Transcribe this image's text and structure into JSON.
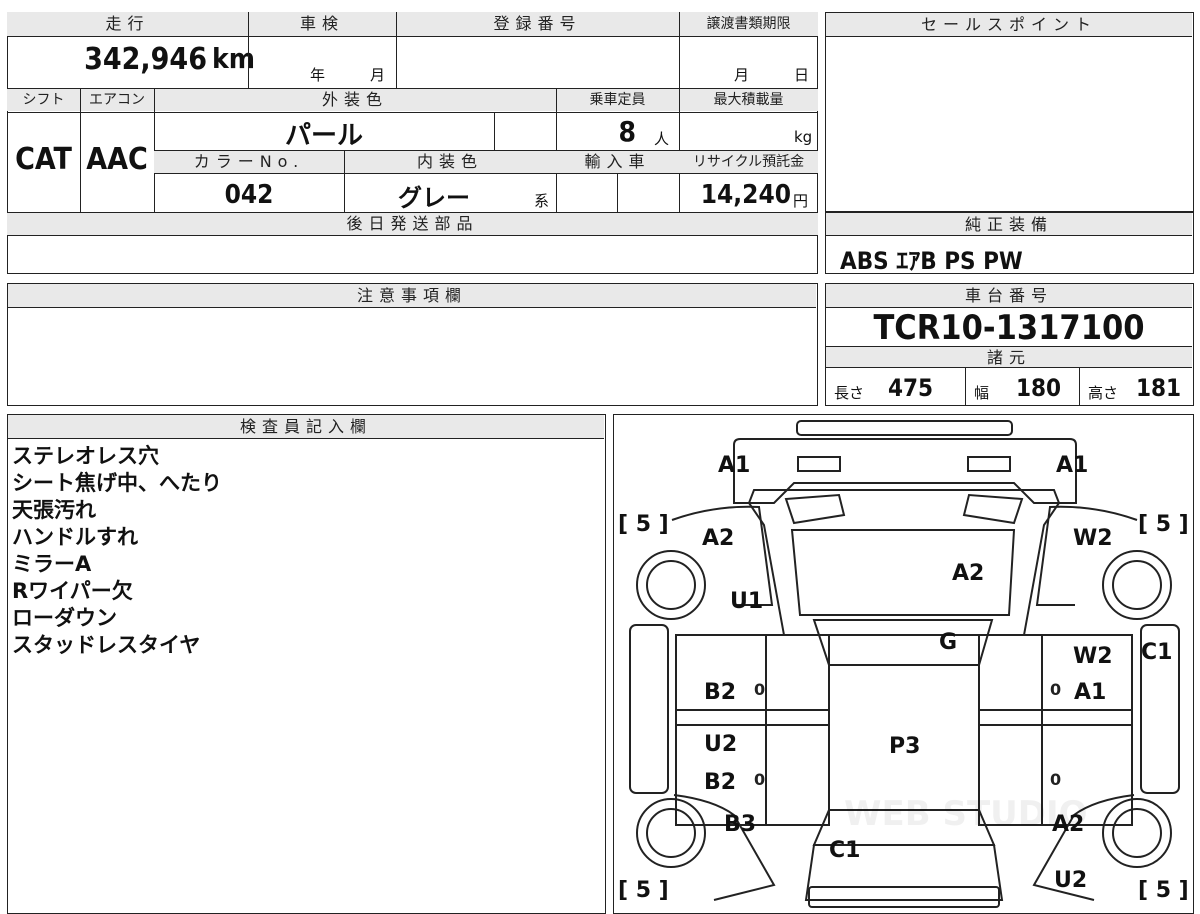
{
  "vehicle": {
    "mileage_header": "走行",
    "mileage_value": "342,946",
    "mileage_unit": "km",
    "inspection_header": "車検",
    "inspection_year_label": "年",
    "inspection_month_label": "月",
    "registration_header": "登録番号",
    "transfer_header": "譲渡書類期限",
    "transfer_month_label": "月",
    "transfer_day_label": "日",
    "shift_header": "シフト",
    "shift_value": "CAT",
    "aircon_header": "エアコン",
    "aircon_value": "AAC",
    "exterior_color_header": "外装色",
    "exterior_color_value": "パール",
    "capacity_header": "乗車定員",
    "capacity_value": "8",
    "capacity_unit": "人",
    "max_load_header": "最大積載量",
    "max_load_unit": "kg",
    "color_no_header": "カラーNo.",
    "color_no_value": "042",
    "interior_color_header": "内装色",
    "interior_color_value": "グレー",
    "interior_color_suffix": "系",
    "import_header": "輸入車",
    "recycle_header": "リサイクル預託金",
    "recycle_value": "14,240",
    "recycle_unit": "円",
    "later_parts_header": "後日発送部品"
  },
  "sales_point": {
    "header": "セールスポイント"
  },
  "equipment": {
    "header": "純正装備",
    "value": "ABS ｴｱB PS PW"
  },
  "notes_section": {
    "header": "注意事項欄"
  },
  "chassis": {
    "header": "車台番号",
    "value": "TCR10-1317100",
    "specs_header": "諸元",
    "length_label": "長さ",
    "length_value": "475",
    "width_label": "幅",
    "width_value": "180",
    "height_label": "高さ",
    "height_value": "181"
  },
  "inspector": {
    "header": "検査員記入欄",
    "lines": [
      "ステレオレス穴",
      "シート焦げ中、へたり",
      "天張汚れ",
      "ハンドルすれ",
      "ミラーA",
      "Rワイパー欠",
      "ローダウン",
      "スタッドレスタイヤ"
    ]
  },
  "diagram": {
    "tire_bracket_fl": "[ 5 ]",
    "tire_bracket_fr": "[ 5 ]",
    "tire_bracket_rl": "[ 5 ]",
    "tire_bracket_rr": "[ 5 ]",
    "a1_left": "A1",
    "a1_right": "A1",
    "a2_front_left": "A2",
    "w2_front_right": "W2",
    "a2_hood": "A2",
    "u1_left": "U1",
    "g_windshield": "G",
    "w2_right_door": "W2",
    "c1_right": "C1",
    "b2_left_upper": "B2",
    "a1_right_door": "A1",
    "u2_left": "U2",
    "p3_roof": "P3",
    "b2_left_lower": "B2",
    "b3_left": "B3",
    "a2_right_rear": "A2",
    "c1_rear": "C1",
    "u2_right": "U2",
    "zero_mark": "0",
    "watermark": "WEB STUDIO"
  }
}
